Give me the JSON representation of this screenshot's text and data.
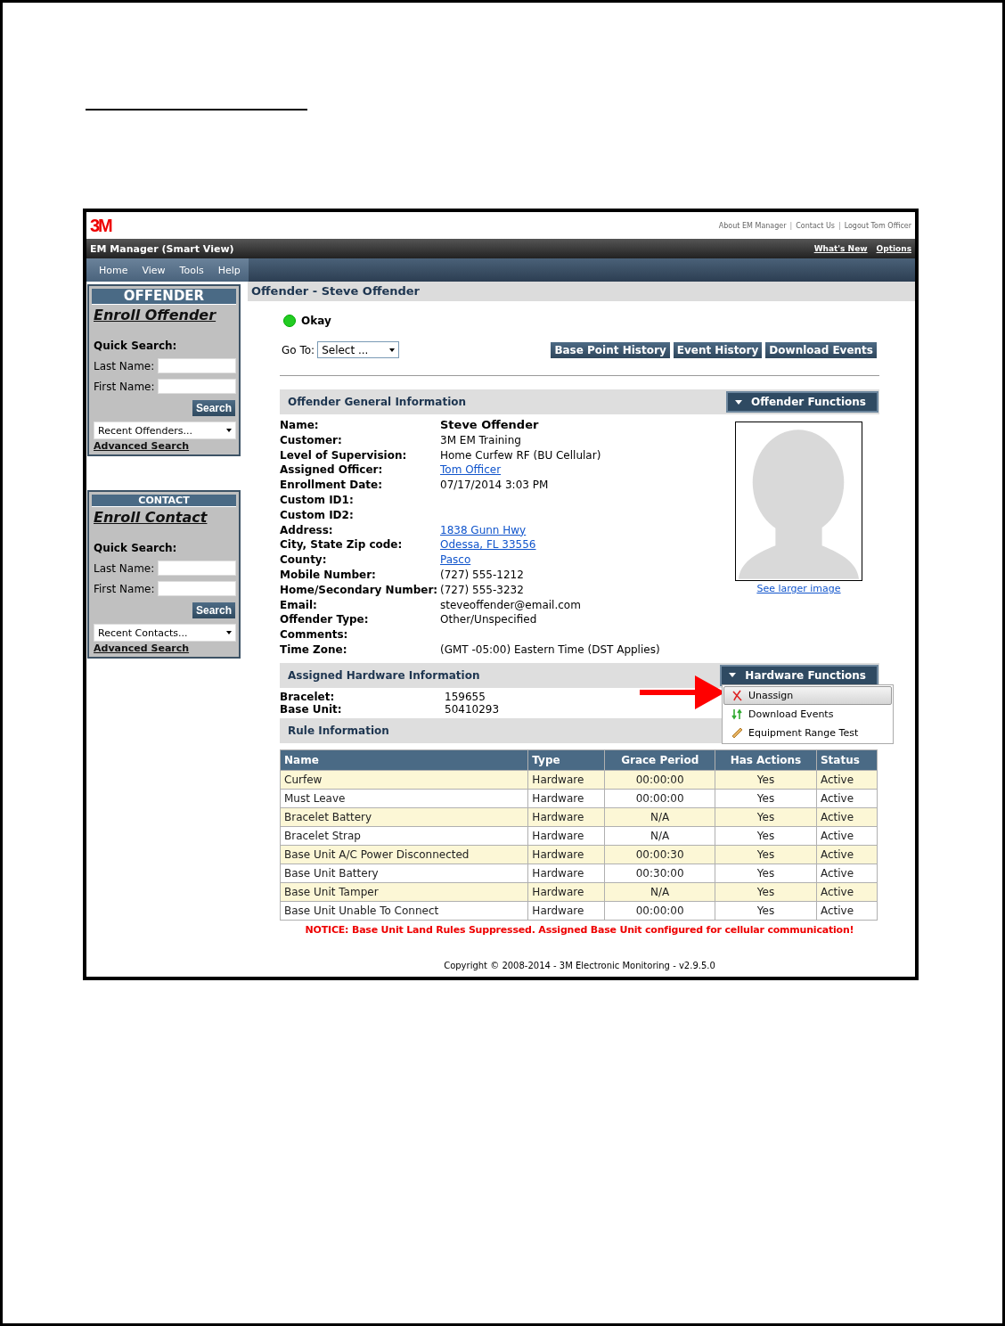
{
  "header": {
    "logo": "3M",
    "top_links": [
      {
        "text": "About EM Manager",
        "kind": "link"
      },
      {
        "text": "|",
        "kind": "separator"
      },
      {
        "text": "Contact Us",
        "kind": "link"
      },
      {
        "text": "|",
        "kind": "separator"
      },
      {
        "text": "Logout Tom Officer",
        "kind": "link"
      }
    ],
    "app_title": "EM Manager (Smart View)",
    "bar_links": [
      "What's New",
      "Options"
    ]
  },
  "menu": [
    "Home",
    "View",
    "Tools",
    "Help"
  ],
  "sidebar": [
    {
      "title": "OFFENDER",
      "enroll": "Enroll Offender",
      "quick_search": "Quick Search:",
      "fields": [
        {
          "label": "Last Name:"
        },
        {
          "label": "First Name:"
        }
      ],
      "search_button": "Search",
      "recent": "Recent Offenders...",
      "advanced": "Advanced Search"
    },
    {
      "title": "CONTACT",
      "enroll": "Enroll Contact",
      "quick_search": "Quick Search:",
      "fields": [
        {
          "label": "Last Name:"
        },
        {
          "label": "First Name:"
        }
      ],
      "search_button": "Search",
      "recent": "Recent Contacts...",
      "advanced": "Advanced Search"
    }
  ],
  "page_title": "Offender - Steve Offender",
  "status": {
    "label": "Okay",
    "color": "#22cc22"
  },
  "goto": {
    "label": "Go To:",
    "value": "Select ..."
  },
  "action_buttons": [
    "Base Point History",
    "Event History",
    "Download Events"
  ],
  "general": {
    "title": "Offender General Information",
    "functions": "Offender Functions",
    "see_larger": "See larger image",
    "rows": [
      {
        "label": "Name:",
        "value": "Steve Offender",
        "kind": "title"
      },
      {
        "label": "Customer:",
        "value": "3M EM Training",
        "kind": "text"
      },
      {
        "label": "Level of Supervision:",
        "value": "Home Curfew RF (BU Cellular)",
        "kind": "text"
      },
      {
        "label": "Assigned Officer:",
        "value": "Tom Officer",
        "kind": "link"
      },
      {
        "label": "Enrollment Date:",
        "value": "07/17/2014 3:03 PM",
        "kind": "text"
      },
      {
        "label": "Custom ID1:"
      },
      {
        "label": "Custom ID2:"
      },
      {
        "label": "Address:",
        "value": "1838 Gunn Hwy",
        "kind": "link"
      },
      {
        "label": "City, State Zip code:",
        "value": "Odessa, FL 33556",
        "kind": "link"
      },
      {
        "label": "County:",
        "value": "Pasco",
        "kind": "link"
      },
      {
        "label": "Mobile Number:",
        "value": "(727) 555-1212",
        "kind": "text"
      },
      {
        "label": "Home/Secondary Number:",
        "value": "(727) 555-3232",
        "kind": "text"
      },
      {
        "label": "Email:",
        "value": "steveoffender@email.com",
        "kind": "text"
      },
      {
        "label": "Offender Type:",
        "value": "Other/Unspecified",
        "kind": "text"
      },
      {
        "label": "Comments:"
      },
      {
        "label": "Time Zone:",
        "value": "(GMT -05:00) Eastern Time (DST Applies)",
        "kind": "text"
      }
    ]
  },
  "hardware": {
    "title": "Assigned Hardware Information",
    "functions": "Hardware Functions",
    "rows": [
      {
        "label": "Bracelet:",
        "value": "159655"
      },
      {
        "label": "Base Unit:",
        "value": "50410293"
      }
    ],
    "menu": [
      {
        "label": "Unassign",
        "kind": "unassign",
        "selected": true
      },
      {
        "label": "Download Events",
        "kind": "download",
        "selected": false
      },
      {
        "label": "Equipment Range Test",
        "kind": "range-test",
        "selected": false
      }
    ]
  },
  "rules": {
    "title": "Rule Information",
    "columns": [
      "Name",
      "Type",
      "Grace Period",
      "Has Actions",
      "Status"
    ],
    "rows": [
      [
        "Curfew",
        "Hardware",
        "00:00:00",
        "Yes",
        "Active"
      ],
      [
        "Must Leave",
        "Hardware",
        "00:00:00",
        "Yes",
        "Active"
      ],
      [
        "Bracelet Battery",
        "Hardware",
        "N/A",
        "Yes",
        "Active"
      ],
      [
        "Bracelet Strap",
        "Hardware",
        "N/A",
        "Yes",
        "Active"
      ],
      [
        "Base Unit A/C Power Disconnected",
        "Hardware",
        "00:00:30",
        "Yes",
        "Active"
      ],
      [
        "Base Unit Battery",
        "Hardware",
        "00:30:00",
        "Yes",
        "Active"
      ],
      [
        "Base Unit Tamper",
        "Hardware",
        "N/A",
        "Yes",
        "Active"
      ],
      [
        "Base Unit Unable To Connect",
        "Hardware",
        "00:00:00",
        "Yes",
        "Active"
      ]
    ],
    "notice": "NOTICE: Base Unit Land Rules Suppressed. Assigned Base Unit configured for cellular communication!"
  },
  "copyright": "Copyright © 2008-2014 - 3M Electronic Monitoring - v2.9.5.0"
}
